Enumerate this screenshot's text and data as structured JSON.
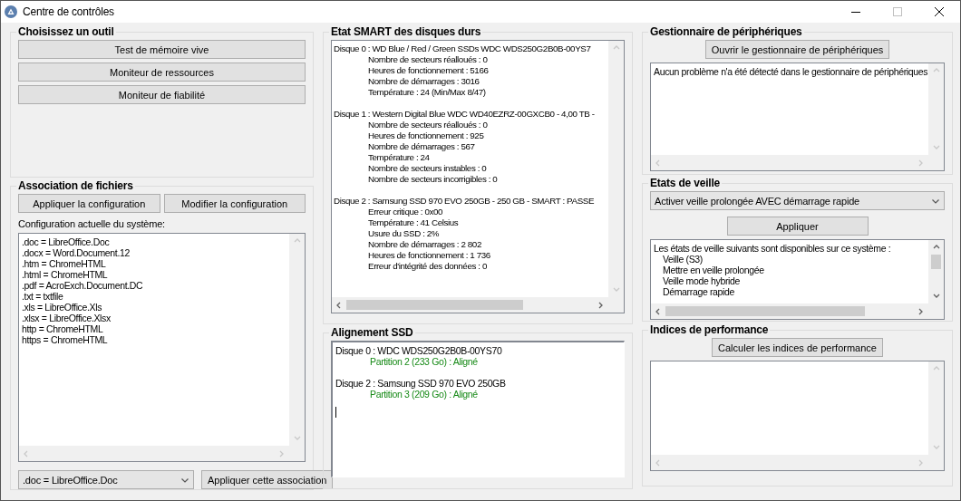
{
  "window": {
    "title": "Centre de contrôles"
  },
  "tools": {
    "title": "Choisissez un outil",
    "buttons": [
      "Test de mémoire vive",
      "Moniteur de ressources",
      "Moniteur de fiabilité"
    ]
  },
  "file_association": {
    "title": "Association de fichiers",
    "buttons": [
      "Appliquer la configuration",
      "Modifier la configuration"
    ],
    "label": "Configuration actuelle du système:",
    "lines": [
      ".doc = LibreOffice.Doc",
      ".docx = Word.Document.12",
      ".htm = ChromeHTML",
      ".html = ChromeHTML",
      ".pdf = AcroExch.Document.DC",
      ".txt = txtfile",
      ".xls = LibreOffice.Xls",
      ".xlsx = LibreOffice.Xlsx",
      "http = ChromeHTML",
      "https = ChromeHTML"
    ],
    "select": {
      "value": ".doc =  LibreOffice.Doc"
    },
    "apply_button": "Appliquer cette association"
  },
  "smart": {
    "title": "Etat SMART des disques durs",
    "disks": [
      {
        "header": "Disque 0 : WD Blue / Red / Green SSDs WDC WDS250G2B0B-00YS7",
        "details": [
          "Nombre de secteurs réalloués : 0",
          "Heures de fonctionnement : 5166",
          "Nombre de démarrages : 3016",
          "Température : 24 (Min/Max 8/47)"
        ]
      },
      {
        "header": "Disque 1 : Western Digital Blue WDC WD40EZRZ-00GXCB0 - 4,00 TB -",
        "details": [
          "Nombre de secteurs réalloués : 0",
          "Heures de fonctionnement : 925",
          "Nombre de démarrages : 567",
          "Température : 24",
          "Nombre de secteurs instables : 0",
          "Nombre de secteurs incorrigibles : 0"
        ]
      },
      {
        "header": "Disque 2 : Samsung SSD 970 EVO 250GB - 250 GB - SMART : PASSE",
        "details": [
          "Erreur critique : 0x00",
          "Température : 41 Celsius",
          "Usure du SSD : 2%",
          "Nombre de démarrages : 2 802",
          "Heures de fonctionnement : 1 736",
          "Erreur d'intégrité des données : 0"
        ]
      }
    ]
  },
  "ssd_alignment": {
    "title": "Alignement SSD",
    "disks": [
      {
        "header": "Disque 0 : WDC WDS250G2B0B-00YS70",
        "partition": "Partition 2 (233 Go) : Aligné"
      },
      {
        "header": "Disque 2 : Samsung SSD 970 EVO 250GB",
        "partition": "Partition 3 (209 Go) : Aligné"
      }
    ]
  },
  "device_manager": {
    "title": "Gestionnaire de périphériques",
    "button": "Ouvrir le gestionnaire de périphériques",
    "message": "Aucun problème n'a été détecté dans le gestionnaire de périphériques"
  },
  "sleep_states": {
    "title": "Etats de veille",
    "select": {
      "value": "Activer veille prolongée AVEC démarrage rapide"
    },
    "button": "Appliquer",
    "intro": "Les états de veille suivants sont disponibles sur ce système :",
    "states": [
      "Veille (S3)",
      "Mettre en veille prolongée",
      "Veille mode hybride",
      "Démarrage rapide"
    ]
  },
  "performance": {
    "title": "Indices de performance",
    "button": "Calculer les indices de performance"
  }
}
